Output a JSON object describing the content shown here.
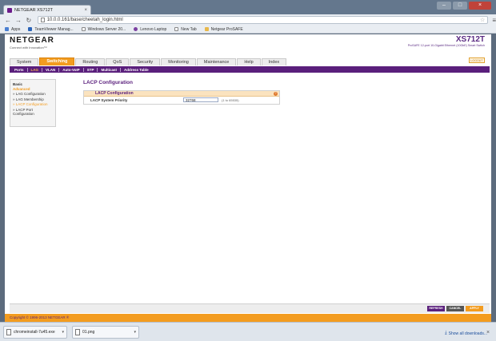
{
  "browser": {
    "tab_title": "NETGEAR XS712T",
    "url": "10.0.0.161/base/cheetah_login.html",
    "bookmarks": [
      "Apps",
      "TeamViewer Manag...",
      "Windows Server 20...",
      "Lenovo Laptop",
      "New Tab",
      "Netgear ProSAFE"
    ]
  },
  "brand": {
    "logo": "NETGEAR",
    "tagline": "Connect with Innovation™",
    "model": "XS712T",
    "model_desc": "ProSAFE 12-port 10-Gigabit Ethernet (10GbE) Smart Switch",
    "logout": "LOGOUT"
  },
  "main_tabs": [
    "System",
    "Switching",
    "Routing",
    "QoS",
    "Security",
    "Monitoring",
    "Maintenance",
    "Help",
    "Index"
  ],
  "sub_tabs": [
    "Ports",
    "LAG",
    "VLAN",
    "Auto-VoIP",
    "STP",
    "Multicast",
    "Address Table"
  ],
  "sidebar": {
    "basic": "Basic",
    "advanced": "Advanced",
    "items": [
      "» LAG Configuration",
      "» LAG Membership",
      "» LACP Configuration",
      "» LACP Port Configuration"
    ]
  },
  "content": {
    "title": "LACP Configuration",
    "panel_title": "LACP Configuration",
    "row_label": "LACP System Priority",
    "value": "32768",
    "range": "(1 to 65535)"
  },
  "footer": {
    "refresh": "REFRESH",
    "cancel": "CANCEL",
    "apply": "APPLY",
    "copyright": "Copyright © 1996-2013 NETGEAR ®"
  },
  "downloads": {
    "file1": "chromeinstall-7u45.exe",
    "file2": "01.png",
    "show_all": "Show all downloads..."
  },
  "colors": {
    "purple": "#5a1f7c",
    "orange": "#f39c1f"
  }
}
